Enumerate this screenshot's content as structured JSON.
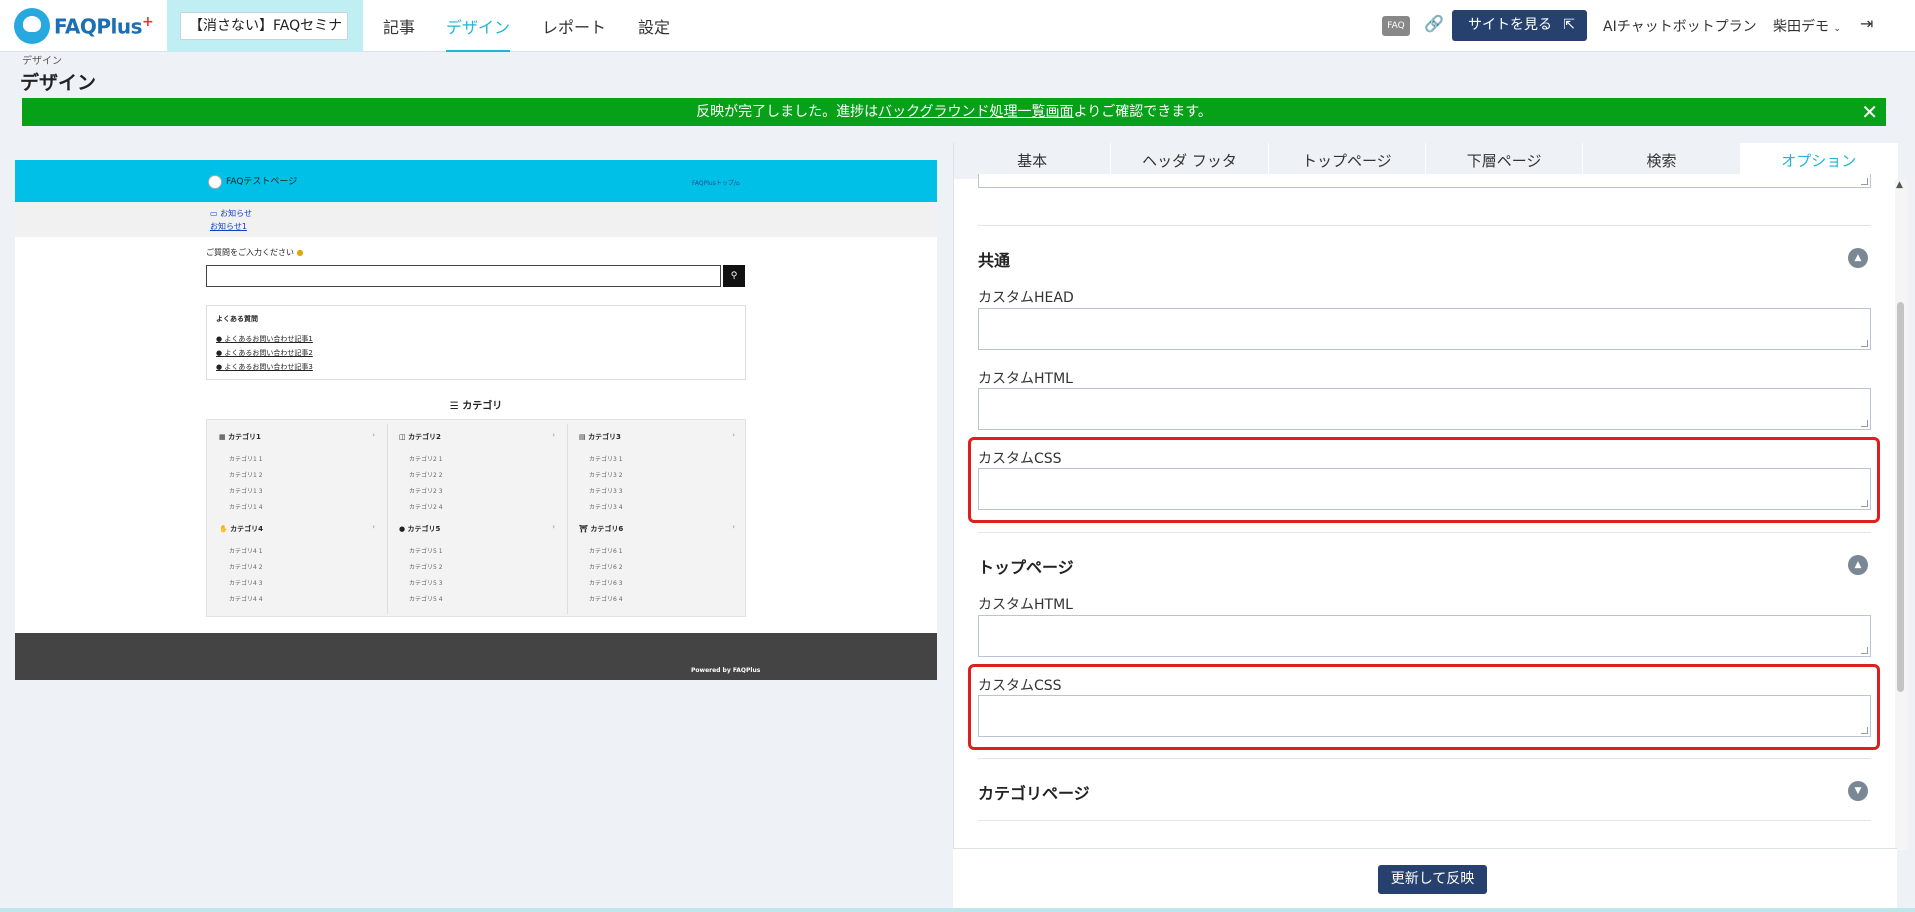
{
  "nav": {
    "logo_text": "FAQPlus",
    "logo_plus": "+",
    "site_selector": "【消さない】FAQセミナ",
    "items": [
      {
        "label": "記事"
      },
      {
        "label": "デザイン"
      },
      {
        "label": "レポート"
      },
      {
        "label": "設定"
      }
    ],
    "faq_badge": "FAQ",
    "view_site_label": "サイトを見る",
    "plan": "AIチャットボットプラン",
    "user": "柴田デモ"
  },
  "page": {
    "breadcrumb": "デザイン",
    "title": "デザイン",
    "alert": {
      "before": "反映が完了しました。進捗は",
      "link": "バックグラウンド処理一覧画面",
      "after": "よりご確認できます。"
    }
  },
  "preview": {
    "site_name": "FAQテストページ",
    "breadcrumb": "FAQPlusトップ/",
    "notices": [
      "お知らせ",
      "お知らせ1"
    ],
    "search_prompt": "ご質問をご入力ください",
    "faq_heading": "よくある質問",
    "faq_items": [
      "よくあるお問い合わせ記事1",
      "よくあるお問い合わせ記事2",
      "よくあるお問い合わせ記事3"
    ],
    "category_title": "カテゴリ",
    "categories": [
      {
        "name": "カテゴリ1",
        "subs": [
          "カテゴリ1 1",
          "カテゴリ1 2",
          "カテゴリ1 3",
          "カテゴリ1 4"
        ]
      },
      {
        "name": "カテゴリ2",
        "subs": [
          "カテゴリ2 1",
          "カテゴリ2 2",
          "カテゴリ2 3",
          "カテゴリ2 4"
        ]
      },
      {
        "name": "カテゴリ3",
        "subs": [
          "カテゴリ3 1",
          "カテゴリ3 2",
          "カテゴリ3 3",
          "カテゴリ3 4"
        ]
      },
      {
        "name": "カテゴリ4",
        "subs": [
          "カテゴリ4 1",
          "カテゴリ4 2",
          "カテゴリ4 3",
          "カテゴリ4 4"
        ]
      },
      {
        "name": "カテゴリ5",
        "subs": [
          "カテゴリ5 1",
          "カテゴリ5 2",
          "カテゴリ5 3",
          "カテゴリ5 4"
        ]
      },
      {
        "name": "カテゴリ6",
        "subs": [
          "カテゴリ6 1",
          "カテゴリ6 2",
          "カテゴリ6 3",
          "カテゴリ6 4"
        ]
      }
    ],
    "footer": "Powered by FAQPlus"
  },
  "panel": {
    "tabs": [
      "基本",
      "ヘッダ フッタ",
      "トップページ",
      "下層ページ",
      "検索",
      "オプション"
    ],
    "sections": {
      "common": {
        "title": "共通",
        "custom_head": "カスタムHEAD",
        "custom_html": "カスタムHTML",
        "custom_css": "カスタムCSS"
      },
      "top": {
        "title": "トップページ",
        "custom_html": "カスタムHTML",
        "custom_css": "カスタムCSS"
      },
      "category": {
        "title": "カテゴリページ"
      }
    },
    "update_button": "更新して反映"
  },
  "colors": {
    "accent": "#1fb6d4",
    "primary_button": "#26416e",
    "alert_green": "#06a019",
    "highlight_red": "#e01e1e",
    "preview_header": "#00c0e8"
  }
}
